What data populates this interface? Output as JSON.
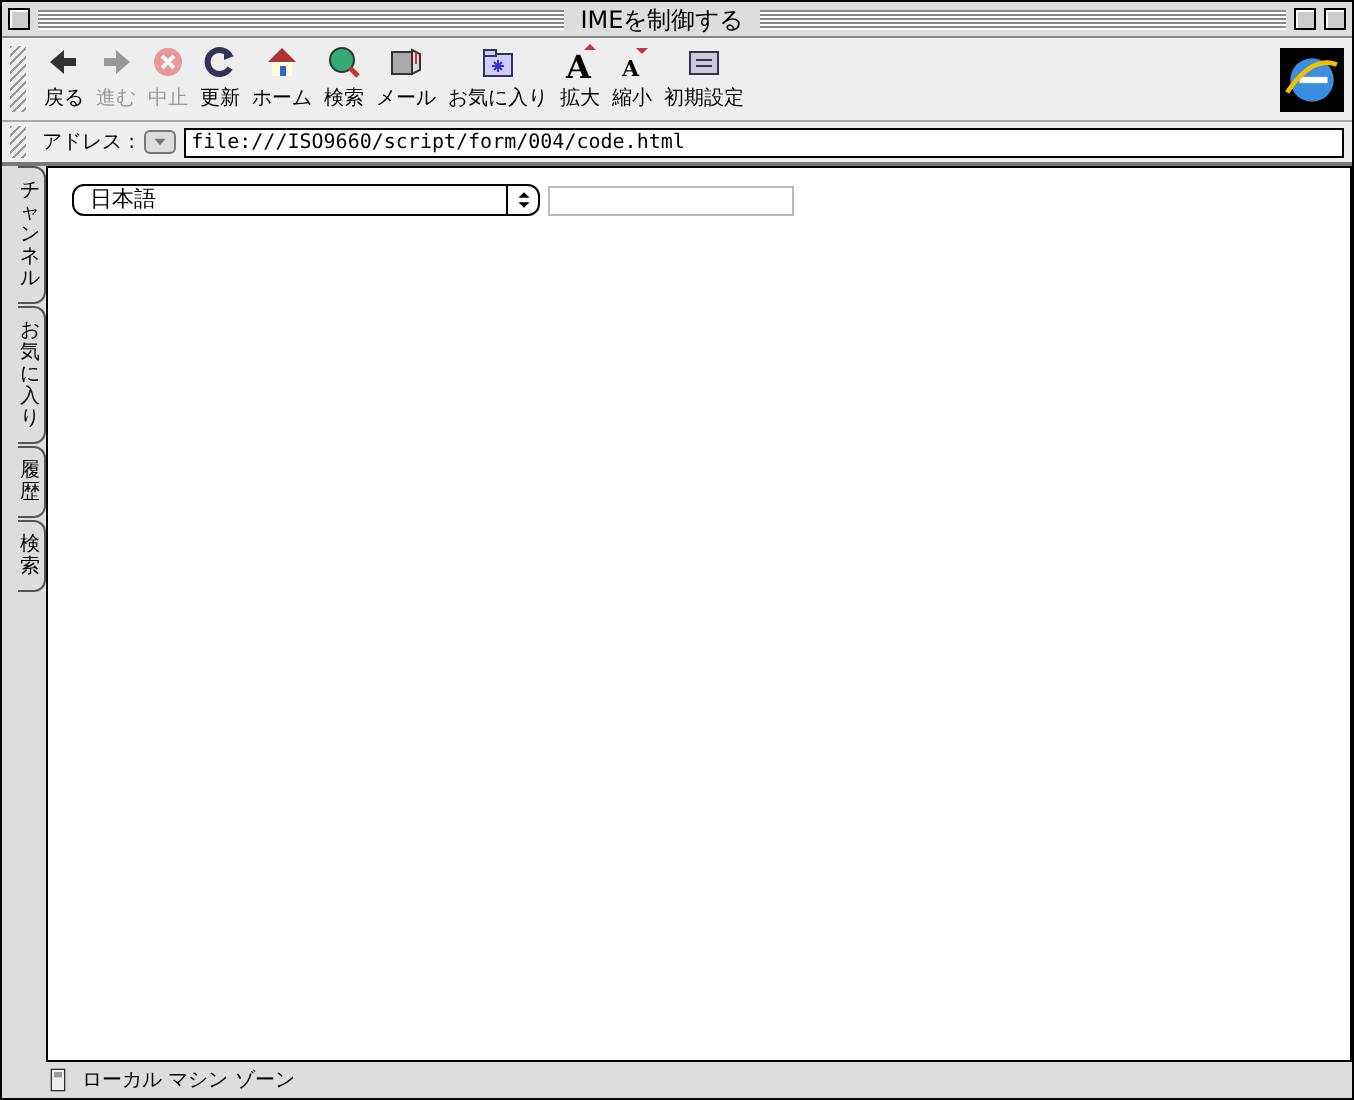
{
  "window": {
    "title": "IMEを制御する"
  },
  "toolbar": {
    "buttons": [
      {
        "label": "戻る",
        "disabled": false
      },
      {
        "label": "進む",
        "disabled": true
      },
      {
        "label": "中止",
        "disabled": true
      },
      {
        "label": "更新",
        "disabled": false
      },
      {
        "label": "ホーム",
        "disabled": false
      },
      {
        "label": "検索",
        "disabled": false
      },
      {
        "label": "メール",
        "disabled": false
      },
      {
        "label": "お気に入り",
        "disabled": false
      },
      {
        "label": "拡大",
        "disabled": false,
        "icon_text": "A"
      },
      {
        "label": "縮小",
        "disabled": false,
        "icon_text": "A"
      },
      {
        "label": "初期設定",
        "disabled": false
      }
    ]
  },
  "address_bar": {
    "label": "アドレス :",
    "value": "file:///ISO9660/script/form/004/code.html"
  },
  "side_tabs": [
    {
      "label": "チャンネル"
    },
    {
      "label": "お気に入り"
    },
    {
      "label": "履歴"
    },
    {
      "label": "検索"
    }
  ],
  "form": {
    "fields": [
      {
        "kind": "select",
        "value": "日本語"
      },
      {
        "kind": "text"
      }
    ]
  },
  "status_bar": {
    "text": "ローカル マシン ゾーン"
  }
}
